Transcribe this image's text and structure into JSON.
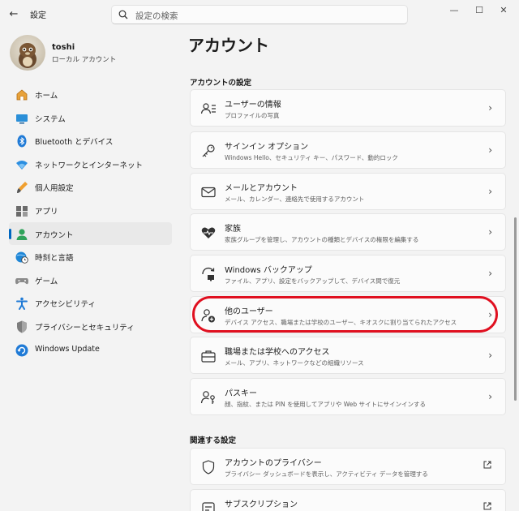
{
  "window": {
    "app_title": "設定",
    "back_glyph": "←",
    "minimize_glyph": "—",
    "maximize_glyph": "☐",
    "close_glyph": "✕"
  },
  "search": {
    "placeholder": "設定の検索"
  },
  "profile": {
    "name": "toshi",
    "account_type": "ローカル アカウント"
  },
  "nav": {
    "items": [
      {
        "label": "ホーム",
        "icon": "home-icon"
      },
      {
        "label": "システム",
        "icon": "monitor-icon"
      },
      {
        "label": "Bluetooth とデバイス",
        "icon": "bluetooth-icon"
      },
      {
        "label": "ネットワークとインターネット",
        "icon": "wifi-icon"
      },
      {
        "label": "個人用設定",
        "icon": "brush-icon"
      },
      {
        "label": "アプリ",
        "icon": "apps-icon"
      },
      {
        "label": "アカウント",
        "icon": "person-icon",
        "active": true
      },
      {
        "label": "時刻と言語",
        "icon": "clock-globe-icon"
      },
      {
        "label": "ゲーム",
        "icon": "gamepad-icon"
      },
      {
        "label": "アクセシビリティ",
        "icon": "accessibility-icon"
      },
      {
        "label": "プライバシーとセキュリティ",
        "icon": "shield-icon"
      },
      {
        "label": "Windows Update",
        "icon": "update-icon"
      }
    ]
  },
  "main": {
    "title": "アカウント",
    "section_account": "アカウントの設定",
    "cards": [
      {
        "title": "ユーザーの情報",
        "subtitle": "プロファイルの写真",
        "icon": "user-info-icon"
      },
      {
        "title": "サインイン オプション",
        "subtitle": "Windows Hello、セキュリティ キー、パスワード、動的ロック",
        "icon": "key-icon"
      },
      {
        "title": "メールとアカウント",
        "subtitle": "メール、カレンダー、連絡先で使用するアカウント",
        "icon": "mail-icon"
      },
      {
        "title": "家族",
        "subtitle": "家族グループを管理し、アカウントの種類とデバイスの権限を編集する",
        "icon": "family-heart-icon"
      },
      {
        "title": "Windows バックアップ",
        "subtitle": "ファイル、アプリ、設定をバックアップして、デバイス間で復元",
        "icon": "backup-icon"
      },
      {
        "title": "他のユーザー",
        "subtitle": "デバイス アクセス、職場または学校のユーザー、キオスクに割り当てられたアクセス",
        "icon": "add-user-icon"
      },
      {
        "title": "職場または学校へのアクセス",
        "subtitle": "メール、アプリ、ネットワークなどの組織リソース",
        "icon": "briefcase-icon"
      },
      {
        "title": "パスキー",
        "subtitle": "顔、指紋、または PIN を使用してアプリや Web サイトにサインインする",
        "icon": "passkey-icon"
      }
    ],
    "section_related": "関連する設定",
    "related_cards": [
      {
        "title": "アカウントのプライバシー",
        "subtitle": "プライバシー ダッシュボードを表示し、アクティビティ データを管理する",
        "icon": "shield-outline-icon"
      },
      {
        "title": "サブスクリプション",
        "subtitle": "",
        "icon": "subscription-icon"
      }
    ],
    "chevron_glyph": "›"
  },
  "colors": {
    "accent": "#0067c0",
    "highlight_ring": "#e01020",
    "background": "#f3f3f3",
    "card": "#fbfbfb"
  }
}
